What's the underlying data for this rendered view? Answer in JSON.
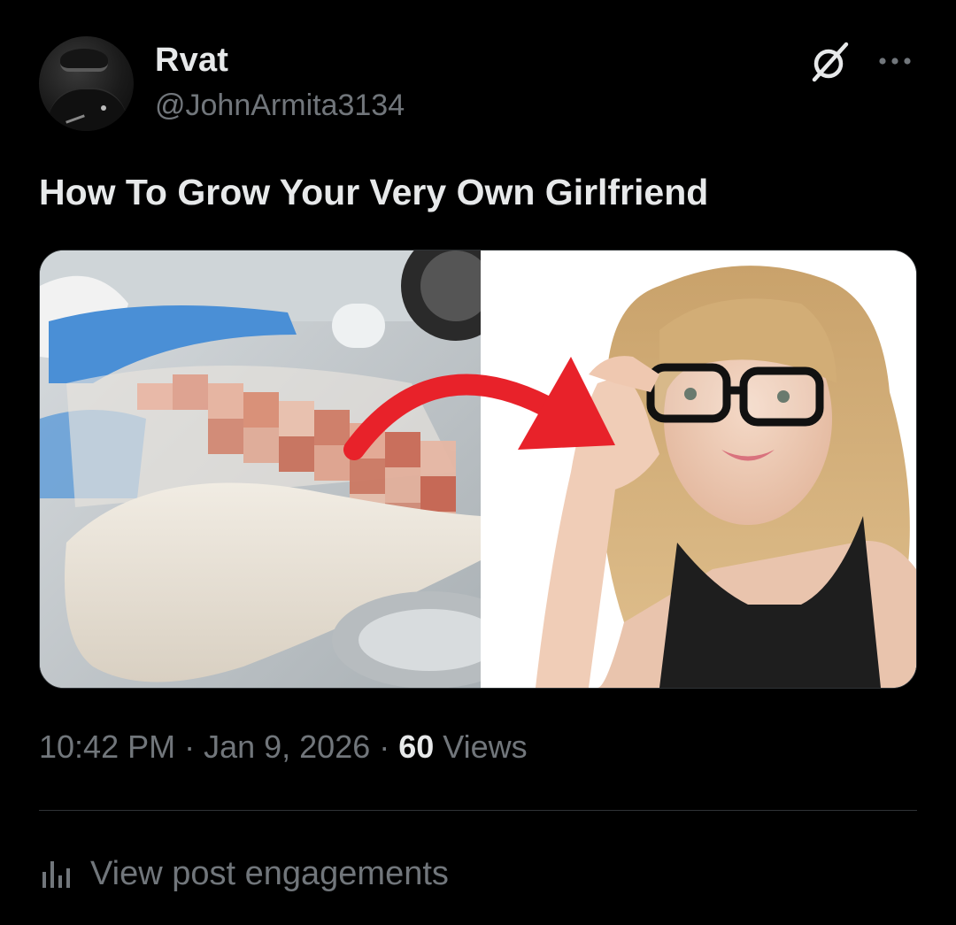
{
  "author": {
    "name": "Rvat",
    "handle": "@JohnArmita3134"
  },
  "icons": {
    "grok": "grok-icon",
    "more": "more-options-icon",
    "engagements": "bar-chart-icon"
  },
  "post": {
    "text": "How To Grow Your Very Own Girlfriend"
  },
  "meta": {
    "time": "10:42 PM",
    "sep1": " · ",
    "date": "Jan 9, 2026",
    "sep2": " · ",
    "views_count": "60",
    "views_label": " Views"
  },
  "engagements": {
    "label": "View post engagements"
  },
  "colors": {
    "background": "#000000",
    "primary_text": "#e7e9ea",
    "secondary_text": "#71767b",
    "divider": "#2f3336",
    "arrow": "#e8222a"
  }
}
